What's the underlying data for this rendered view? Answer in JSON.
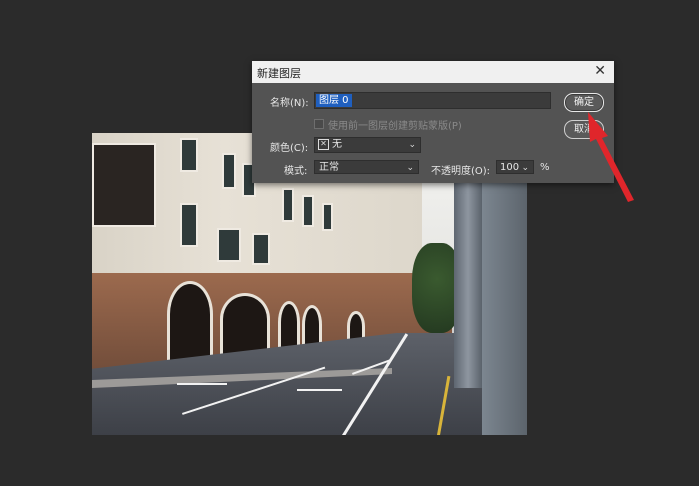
{
  "dialog": {
    "title": "新建图层",
    "name_label": "名称(N):",
    "name_value": "图层 0",
    "clipping_label": "使用前一图层创建剪贴蒙版(P)",
    "color_label": "颜色(C):",
    "color_value": "无",
    "mode_label": "模式:",
    "mode_value": "正常",
    "opacity_label": "不透明度(O):",
    "opacity_value": "100",
    "opacity_unit": "%",
    "ok_label": "确定",
    "cancel_label": "取消"
  },
  "colors": {
    "workspace_bg": "#2b2b2b",
    "dialog_bg": "#535353",
    "selection": "#1f5fbf",
    "annotation_arrow": "#e0262b"
  },
  "icons": {
    "close": "close-icon",
    "color_none": "none-color-swatch-icon",
    "dropdown": "chevron-down-icon"
  }
}
